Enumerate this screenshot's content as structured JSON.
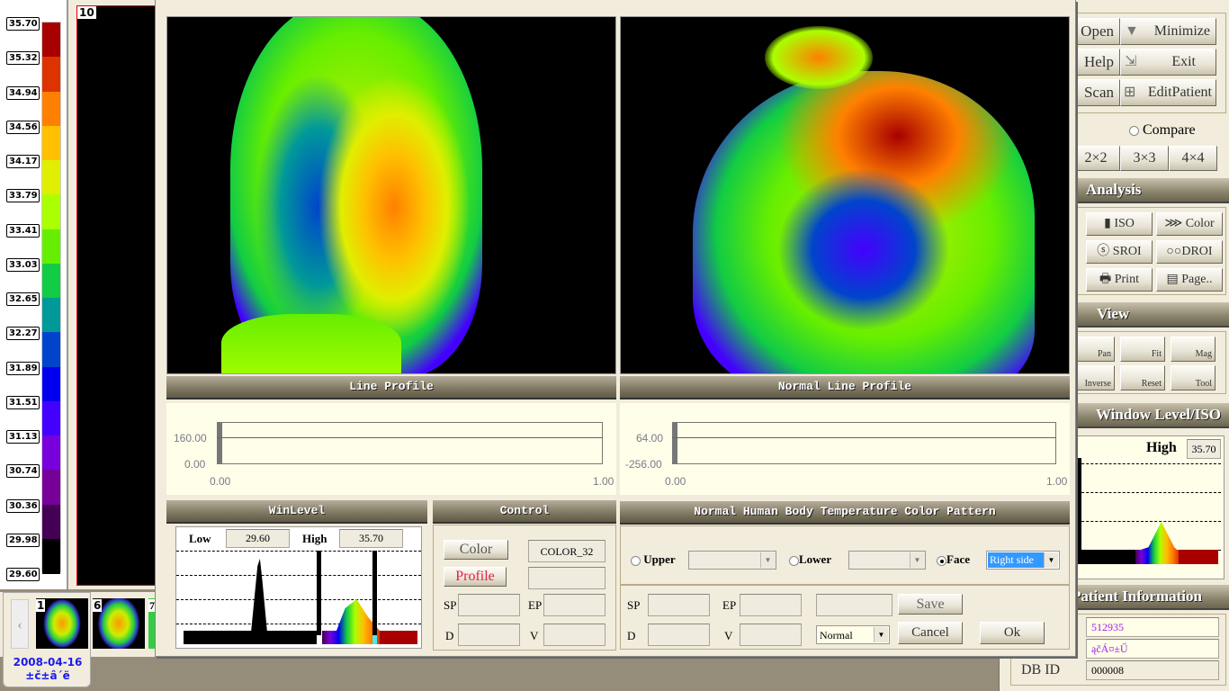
{
  "color_scale": {
    "labels": [
      "35.70",
      "35.32",
      "34.94",
      "34.56",
      "34.17",
      "33.79",
      "33.41",
      "33.03",
      "32.65",
      "32.27",
      "31.89",
      "31.51",
      "31.13",
      "30.74",
      "30.36",
      "29.98",
      "29.60"
    ],
    "colors": [
      "#a80000",
      "#dd3300",
      "#ff8000",
      "#ffc000",
      "#e0ee00",
      "#aaff00",
      "#66ee00",
      "#11cc44",
      "#009999",
      "#0044cc",
      "#0000ee",
      "#4400ff",
      "#7700dd",
      "#770099",
      "#440055",
      "#000000"
    ]
  },
  "image_panel": {
    "index_label": "10"
  },
  "thumbnails": {
    "items": [
      {
        "label": "1"
      },
      {
        "label": "6"
      },
      {
        "label": "7"
      }
    ],
    "date": "2008-04-16",
    "subtitle": "±č±â´ë"
  },
  "dialog": {
    "line_profile": {
      "title": "Line Profile",
      "y_ticks": [
        "160.00",
        "0.00"
      ],
      "x_ticks": [
        "0.00",
        "1.00"
      ]
    },
    "normal_line_profile": {
      "title": "Normal Line Profile",
      "y_ticks": [
        "64.00",
        "-256.00"
      ],
      "x_ticks": [
        "0.00",
        "1.00"
      ]
    },
    "winlevel": {
      "title": "WinLevel",
      "low_label": "Low",
      "low_value": "29.60",
      "high_label": "High",
      "high_value": "35.70"
    },
    "control": {
      "title": "Control",
      "color_button": "Color",
      "color_value": "COLOR_32",
      "profile_button": "Profile",
      "sp": "SP",
      "ep": "EP",
      "d": "D",
      "v": "V"
    },
    "pattern": {
      "title": "Normal Human Body Temperature Color Pattern",
      "upper": "Upper",
      "lower": "Lower",
      "face": "Face",
      "face_selected": true,
      "face_value": "Right side",
      "sp": "SP",
      "ep": "EP",
      "d": "D",
      "v": "V",
      "mode_value": "Normal",
      "save": "Save",
      "cancel": "Cancel",
      "ok": "Ok"
    }
  },
  "right_panel": {
    "buttons": [
      "Open",
      "Minimize",
      "Help",
      "Exit",
      "Scan",
      "EditPatient"
    ],
    "compare": "Compare",
    "layouts": [
      "2×2",
      "3×3",
      "4×4"
    ],
    "analysis_title": "Analysis",
    "analysis_buttons": [
      "ISO",
      "Color",
      "SROI",
      "DROI",
      "Print",
      "Page.."
    ],
    "view_title": "View",
    "view_buttons": [
      "Pan",
      "Fit",
      "Mag",
      "Inverse",
      "Reset",
      "Tool"
    ],
    "window_title": "Window Level/ISO",
    "high_label": "High",
    "high_value": "35.70",
    "patient_title": "Patient Information",
    "patient_id": "512935",
    "patient_name": "ąčÁ¤±Ű",
    "db_id_label": "DB ID",
    "db_id": "000008"
  }
}
